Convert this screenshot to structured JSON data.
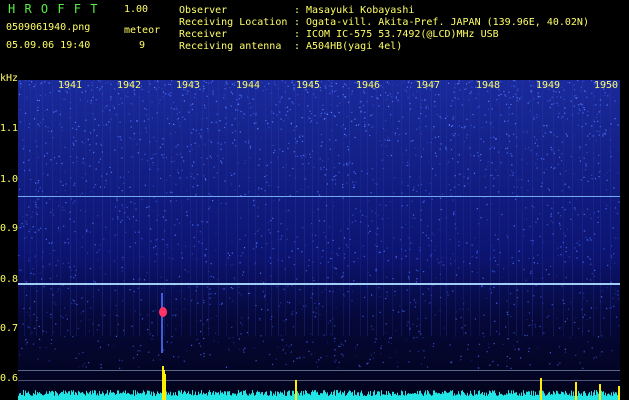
{
  "app": {
    "name": "H R O F F T",
    "version": "1.00"
  },
  "file": {
    "name": "0509061940.png",
    "datetime": "05.09.06 19:40"
  },
  "meteor": {
    "label": "meteor",
    "count": "9"
  },
  "info": [
    {
      "key": "Observer",
      "value": "Masayuki Kobayashi"
    },
    {
      "key": "Receiving Location",
      "value": "Ogata-vill. Akita-Pref. JAPAN (139.96E, 40.02N)"
    },
    {
      "key": "Receiver",
      "value": "ICOM IC-575 53.7492(@LCD)MHz USB"
    },
    {
      "key": "Receiving antenna",
      "value": "A504HB(yagi 4el)"
    }
  ],
  "axes": {
    "y_unit": "kHz",
    "y_ticks": [
      "1.1",
      "1.0",
      "0.9",
      "0.8",
      "0.7",
      "0.6"
    ],
    "x_ticks": [
      "1941",
      "1942",
      "1943",
      "1944",
      "1945",
      "1946",
      "1947",
      "1948",
      "1949",
      "1950"
    ]
  },
  "colors": {
    "header_text": "#ffff66",
    "title": "#55ee44",
    "carrier": "#8fd4ff",
    "spectrum": "#22e6e6",
    "meteor": "#ffee00"
  }
}
